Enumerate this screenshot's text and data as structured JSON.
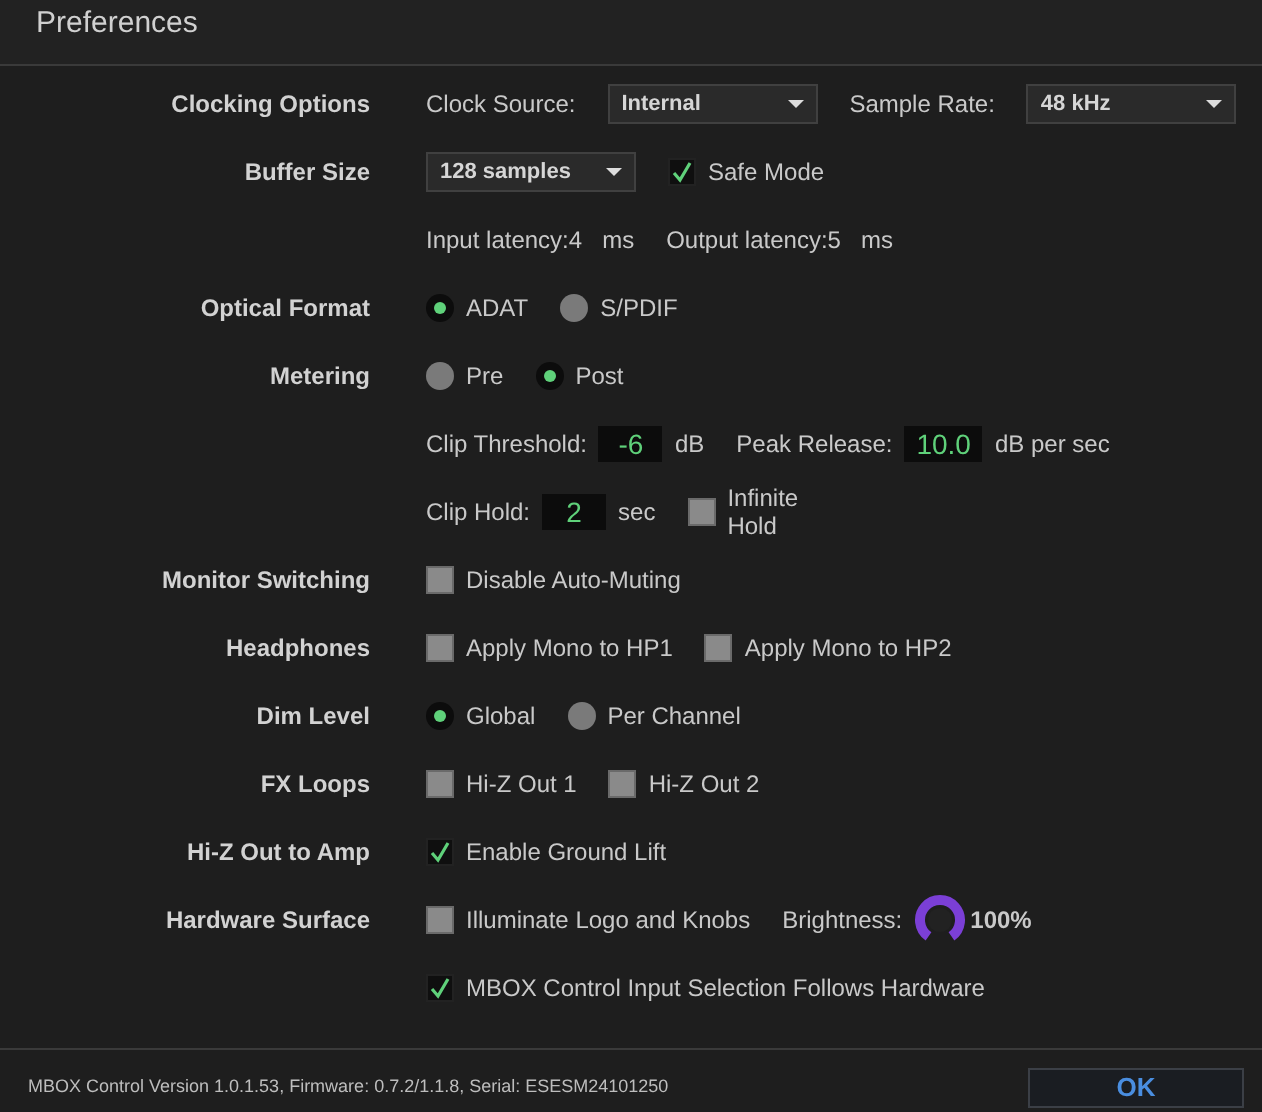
{
  "window": {
    "title": "Preferences"
  },
  "rows": [
    {
      "label": "Clocking Options",
      "controls": [
        {
          "kind": "text",
          "text": "Clock Source:"
        },
        {
          "kind": "select",
          "value": "Internal"
        },
        {
          "kind": "text",
          "text": "Sample Rate:"
        },
        {
          "kind": "select",
          "value": "48 kHz"
        }
      ]
    },
    {
      "label": "Buffer Size",
      "controls": [
        {
          "kind": "select",
          "value": "128 samples"
        },
        {
          "kind": "checkbox",
          "text": "Safe Mode",
          "checked": true
        }
      ]
    },
    {
      "controls": [
        {
          "kind": "readout",
          "text": "Input latency:",
          "value": "4",
          "unit": "ms"
        },
        {
          "kind": "readout",
          "text": "Output latency:",
          "value": "5",
          "unit": "ms"
        }
      ]
    },
    {
      "label": "Optical Format",
      "controls": [
        {
          "kind": "radio",
          "text": "ADAT",
          "selected": true
        },
        {
          "kind": "radio",
          "text": "S/PDIF",
          "selected": false
        }
      ]
    },
    {
      "label": "Metering",
      "controls": [
        {
          "kind": "radio",
          "text": "Pre",
          "selected": false
        },
        {
          "kind": "radio",
          "text": "Post",
          "selected": true
        }
      ]
    },
    {
      "controls": [
        {
          "kind": "number",
          "text": "Clip Threshold:",
          "value": "-6",
          "unit": "dB"
        },
        {
          "kind": "number",
          "text": "Peak Release:",
          "value": "10.0",
          "unit": "dB per sec"
        }
      ]
    },
    {
      "controls": [
        {
          "kind": "number",
          "text": "Clip Hold:",
          "value": "2",
          "unit": "sec"
        },
        {
          "kind": "checkbox",
          "text": "Infinite Hold",
          "checked": false,
          "wrap": true
        }
      ]
    },
    {
      "label": "Monitor Switching",
      "controls": [
        {
          "kind": "checkbox",
          "text": "Disable Auto-Muting",
          "checked": false
        }
      ]
    },
    {
      "label": "Headphones",
      "controls": [
        {
          "kind": "checkbox",
          "text": "Apply Mono to HP1",
          "checked": false
        },
        {
          "kind": "checkbox",
          "text": "Apply Mono to HP2",
          "checked": false
        }
      ]
    },
    {
      "label": "Dim Level",
      "controls": [
        {
          "kind": "radio",
          "text": "Global",
          "selected": true
        },
        {
          "kind": "radio",
          "text": "Per Channel",
          "selected": false
        }
      ]
    },
    {
      "label": "FX Loops",
      "controls": [
        {
          "kind": "checkbox",
          "text": "Hi-Z Out 1",
          "checked": false
        },
        {
          "kind": "checkbox",
          "text": "Hi-Z Out 2",
          "checked": false
        }
      ]
    },
    {
      "label": "Hi-Z Out to Amp",
      "controls": [
        {
          "kind": "checkbox",
          "text": "Enable Ground Lift",
          "checked": true
        }
      ]
    },
    {
      "label": "Hardware Surface",
      "controls": [
        {
          "kind": "checkbox",
          "text": "Illuminate Logo and Knobs",
          "checked": false
        },
        {
          "kind": "text",
          "text": "Brightness:"
        },
        {
          "kind": "knob",
          "reading": "100%"
        }
      ]
    },
    {
      "controls": [
        {
          "kind": "checkbox",
          "text": "MBOX Control Input Selection Follows Hardware",
          "checked": true
        }
      ]
    }
  ],
  "footer": {
    "info": "MBOX Control Version 1.0.1.53, Firmware: 0.7.2/1.1.8, Serial: ESESM24101250",
    "button": "OK"
  }
}
